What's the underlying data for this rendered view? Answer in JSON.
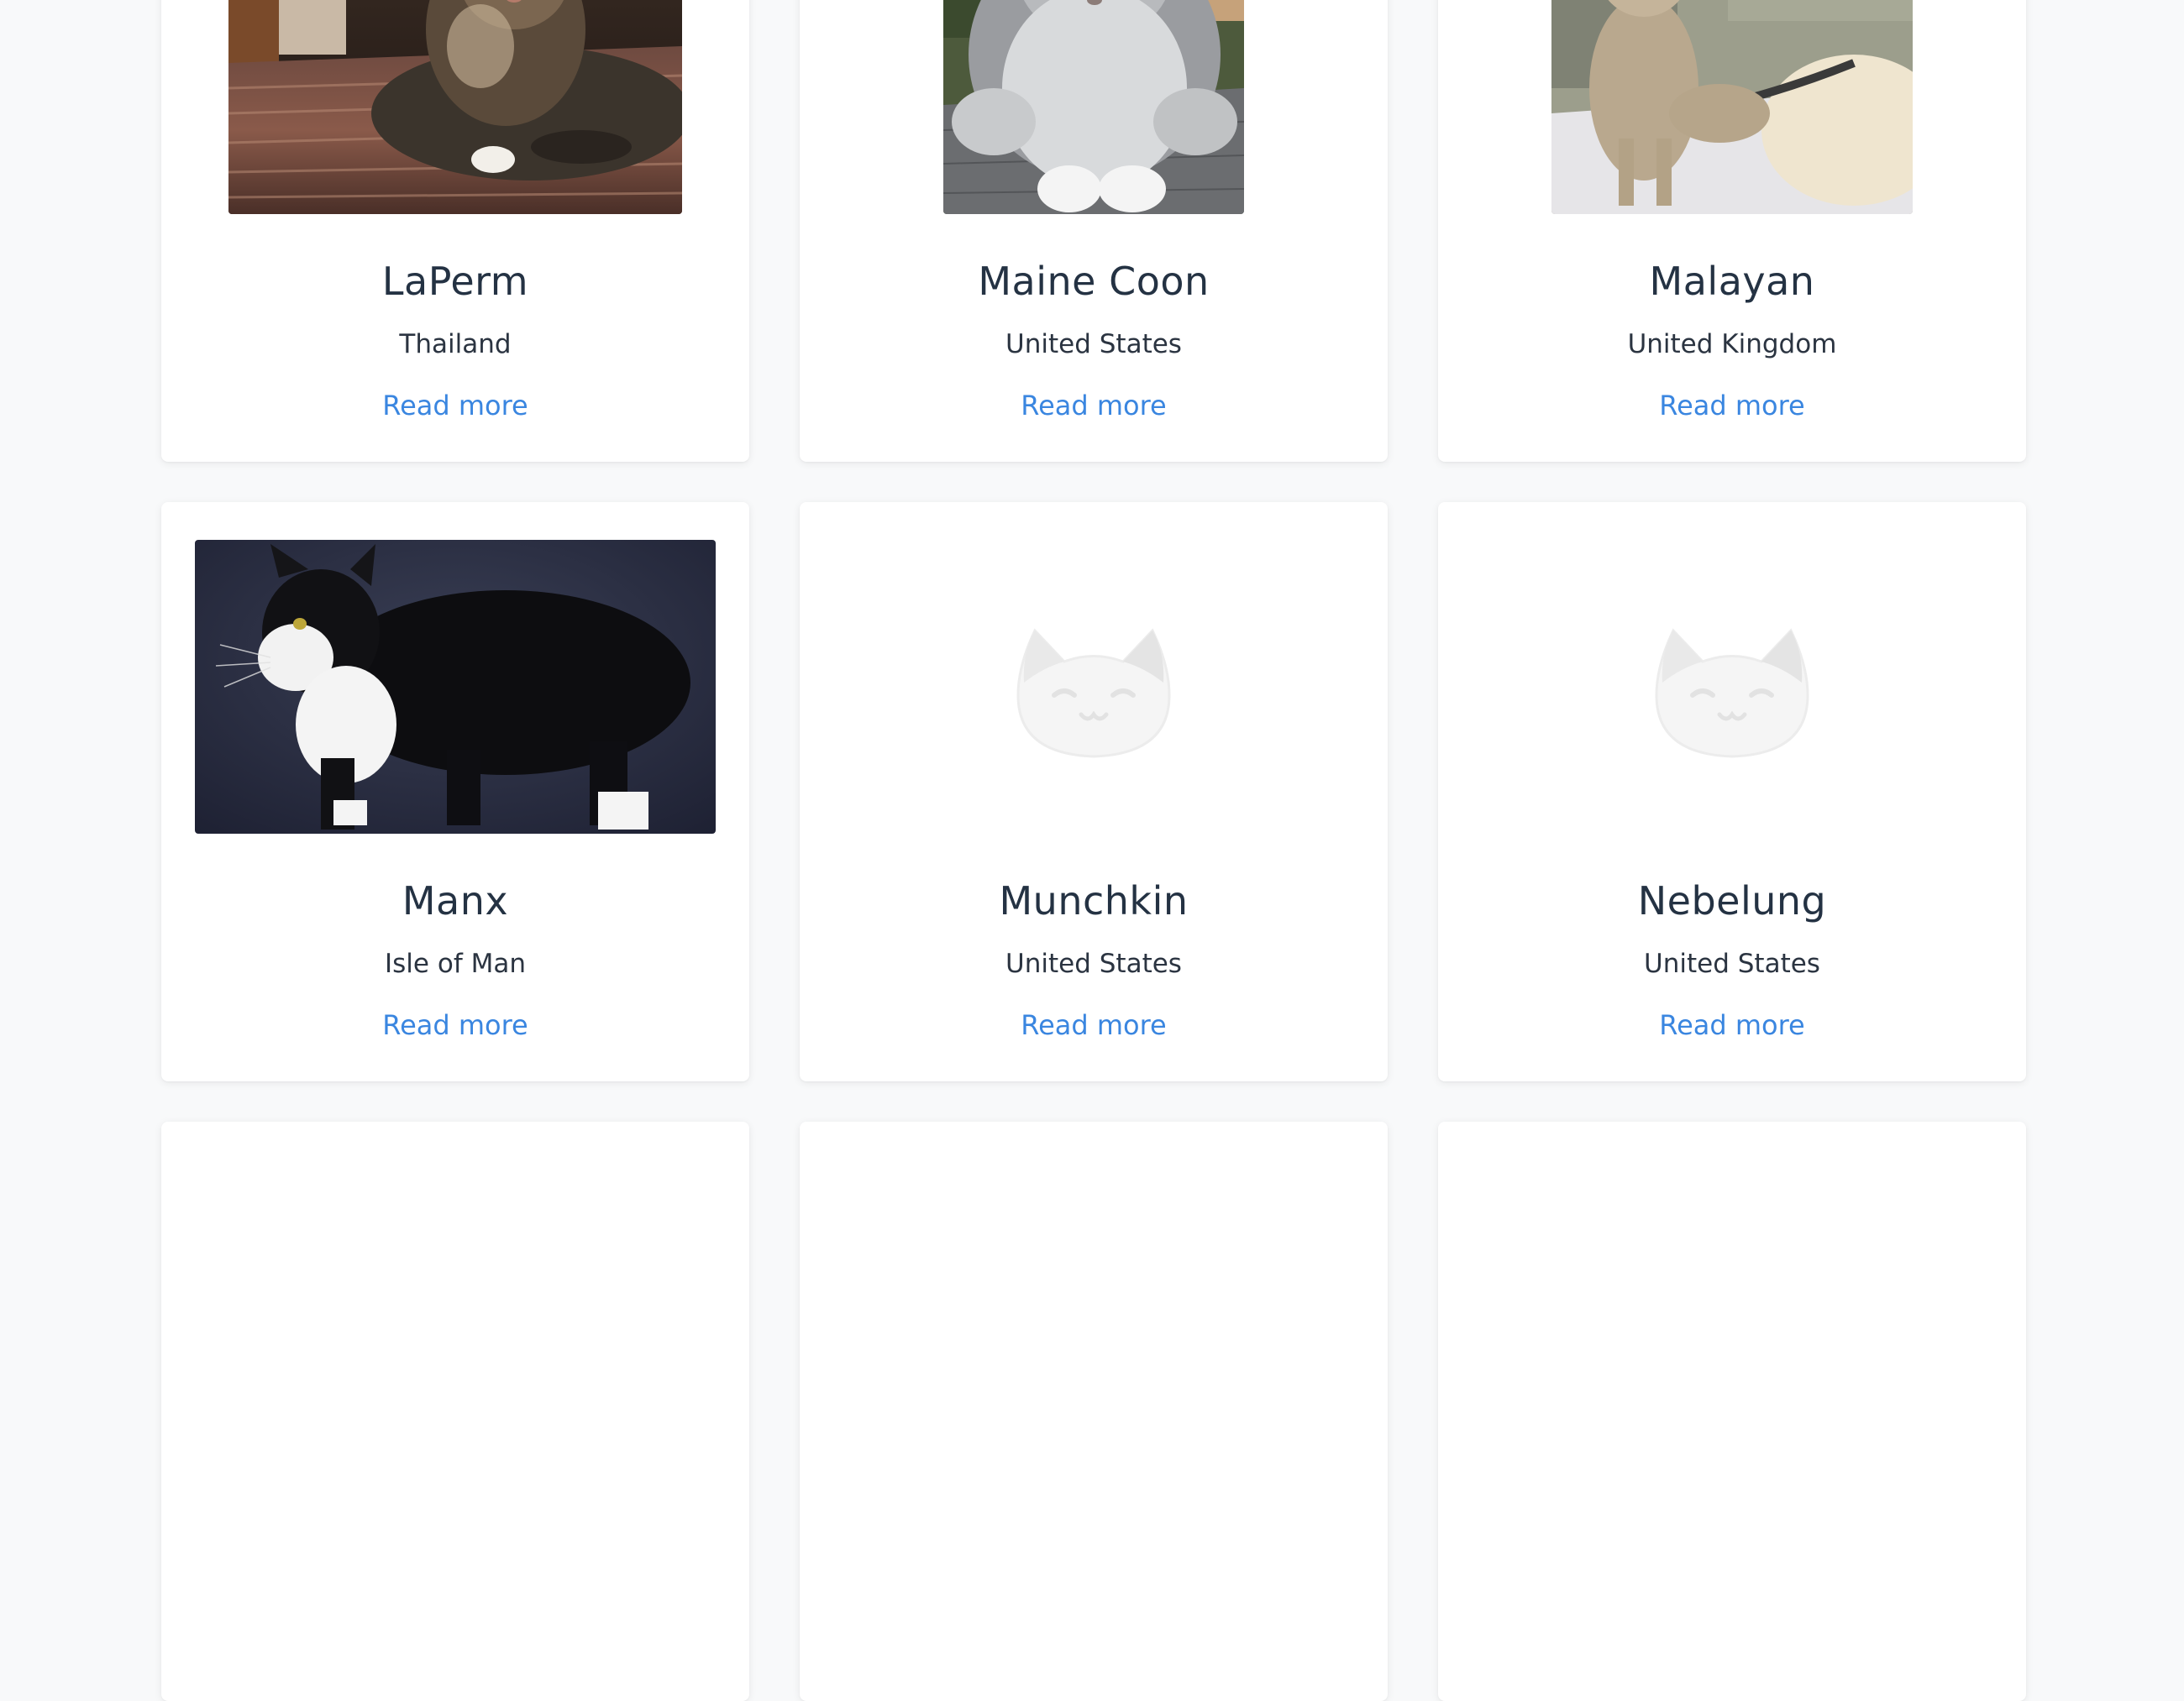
{
  "breeds": [
    {
      "name": "LaPerm",
      "origin": "Thailand",
      "link": "Read more",
      "image": "laperm-photo"
    },
    {
      "name": "Maine Coon",
      "origin": "United States",
      "link": "Read more",
      "image": "maine-coon-photo"
    },
    {
      "name": "Malayan",
      "origin": "United Kingdom",
      "link": "Read more",
      "image": "malayan-photo"
    },
    {
      "name": "Manx",
      "origin": "Isle of Man",
      "link": "Read more",
      "image": "manx-photo"
    },
    {
      "name": "Munchkin",
      "origin": "United States",
      "link": "Read more",
      "image": "cat-placeholder-icon"
    },
    {
      "name": "Nebelung",
      "origin": "United States",
      "link": "Read more",
      "image": "cat-placeholder-icon"
    }
  ],
  "colors": {
    "background": "#f8f9fa",
    "card": "#ffffff",
    "title": "#243243",
    "link": "#3a86e0",
    "placeholder": "#eeeeee"
  }
}
